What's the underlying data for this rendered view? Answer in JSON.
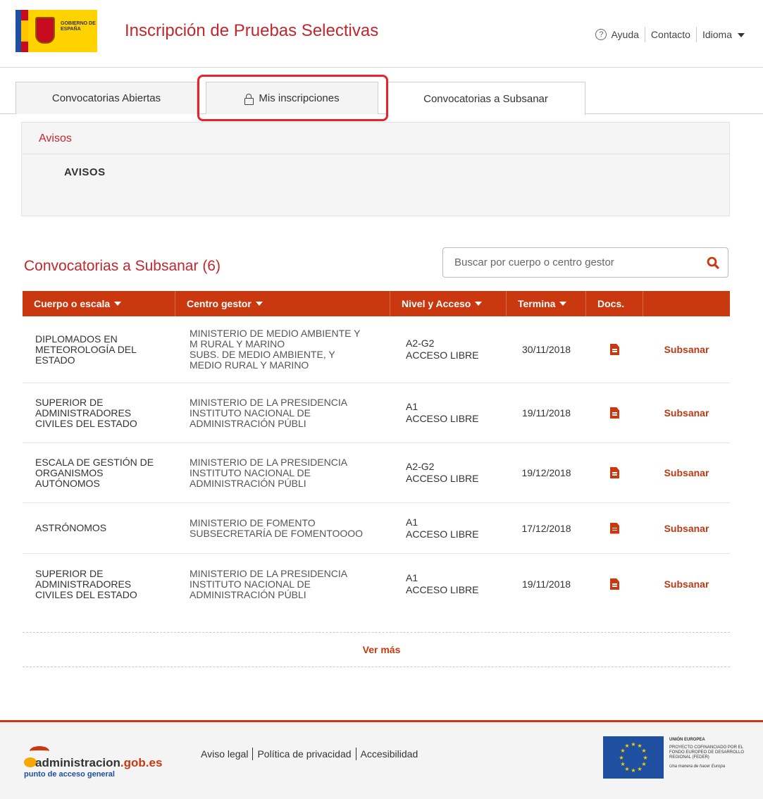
{
  "header": {
    "logo_text": "GOBIERNO DE ESPAÑA",
    "title": "Inscripción de Pruebas Selectivas",
    "help_label": "Ayuda",
    "contact_label": "Contacto",
    "language_label": "Idioma"
  },
  "tabs": [
    {
      "label": "Convocatorias Abiertas",
      "active": false
    },
    {
      "label": "Mis inscripciones",
      "active": false,
      "icon": "lock-icon"
    },
    {
      "label": "Convocatorias a Subsanar",
      "active": true
    }
  ],
  "avisos": {
    "title": "Avisos",
    "body": "AVISOS"
  },
  "section": {
    "title": "Convocatorias a Subsanar (6)"
  },
  "search": {
    "placeholder": "Buscar por cuerpo o centro gestor"
  },
  "table": {
    "headers": [
      "Cuerpo o escala",
      "Centro gestor",
      "Nivel y Acceso",
      "Termina",
      "Docs.",
      ""
    ],
    "action_label": "Subsanar",
    "rows": [
      {
        "cuerpo": [
          "DIPLOMADOS EN",
          "METEOROLOGÍA DEL",
          "ESTADO"
        ],
        "centro": [
          "MINISTERIO DE MEDIO AMBIENTE Y",
          "M RURAL Y MARINO",
          "SUBS. DE MEDIO AMBIENTE, Y",
          "MEDIO RURAL Y MARINO"
        ],
        "nivel": "A2-G2",
        "acceso": "ACCESO LIBRE",
        "termina": "30/11/2018"
      },
      {
        "cuerpo": [
          "SUPERIOR DE",
          "ADMINISTRADORES",
          "CIVILES DEL ESTADO"
        ],
        "centro": [
          "MINISTERIO DE LA PRESIDENCIA",
          "INSTITUTO NACIONAL DE",
          "ADMINISTRACIÓN PÚBLI"
        ],
        "nivel": "A1",
        "acceso": "ACCESO LIBRE",
        "termina": "19/11/2018"
      },
      {
        "cuerpo": [
          "ESCALA DE GESTIÓN DE",
          "ORGANISMOS",
          "AUTÓNOMOS"
        ],
        "centro": [
          "MINISTERIO DE LA PRESIDENCIA",
          "INSTITUTO NACIONAL DE",
          "ADMINISTRACIÓN PÚBLI"
        ],
        "nivel": "A2-G2",
        "acceso": "ACCESO LIBRE",
        "termina": "19/12/2018"
      },
      {
        "cuerpo": [
          "ASTRÓNOMOS"
        ],
        "centro": [
          "MINISTERIO DE FOMENTO",
          "SUBSECRETARÍA DE FOMENTOOOO"
        ],
        "nivel": "A1",
        "acceso": "ACCESO LIBRE",
        "termina": "17/12/2018"
      },
      {
        "cuerpo": [
          "SUPERIOR DE",
          "ADMINISTRADORES",
          "CIVILES DEL ESTADO"
        ],
        "centro": [
          "MINISTERIO DE LA PRESIDENCIA",
          "INSTITUTO NACIONAL DE",
          "ADMINISTRACIÓN PÚBLI"
        ],
        "nivel": "A1",
        "acceso": "ACCESO LIBRE",
        "termina": "19/11/2018"
      }
    ]
  },
  "ver_mas": "Ver más",
  "footer": {
    "logo_name_a": "administracion",
    "logo_name_b": ".gob.es",
    "logo_sub": "punto de acceso general",
    "links": [
      "Aviso legal",
      "Política de privacidad",
      "Accesibilidad"
    ],
    "eu_title": "UNIÓN EUROPEA",
    "eu_body": "PROYECTO COFINANCIADO POR EL FONDO EUROPEO DE DESARROLLO REGIONAL (FEDER)",
    "eu_motto": "Una manera de hacer Europa"
  },
  "colors": {
    "brand_red": "#c1272d",
    "table_header": "#c9380f",
    "highlight": "#e8232b"
  }
}
